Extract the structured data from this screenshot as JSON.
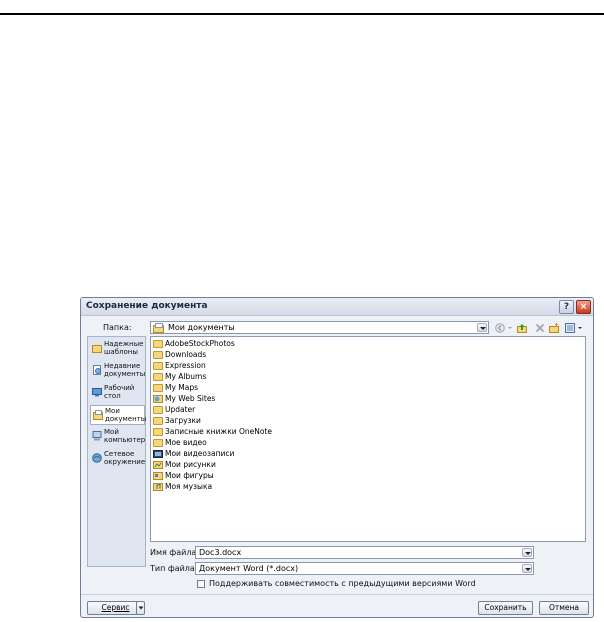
{
  "dialog": {
    "title": "Сохранение документа",
    "help_glyph": "?",
    "close_glyph": "×"
  },
  "folder_label": "Папка:",
  "folder_value": "Мои документы",
  "places": [
    {
      "label": "Надежные шаблоны",
      "icon": "folder-icon"
    },
    {
      "label": "Недавние документы",
      "icon": "recent-docs-icon"
    },
    {
      "label": "Рабочий стол",
      "icon": "desktop-icon"
    },
    {
      "label": "Мои документы",
      "icon": "my-documents-icon"
    },
    {
      "label": "Мой компьютер",
      "icon": "computer-icon"
    },
    {
      "label": "Сетевое окружение",
      "icon": "network-icon"
    }
  ],
  "files": [
    "AdobeStockPhotos",
    "Downloads",
    "Expression",
    "My Albums",
    "My Maps",
    "My Web Sites",
    "Updater",
    "Загрузки",
    "Записные книжки OneNote",
    "Мое видео",
    "Мои видеозаписи",
    "Мои рисунки",
    "Мои фигуры",
    "Моя музыка"
  ],
  "filename_label": "Имя файла:",
  "filename_value": "Doc3.docx",
  "filetype_label": "Тип файла:",
  "filetype_value": "Документ Word (*.docx)",
  "compat_label": "Поддерживать совместимость с предыдущими версиями Word",
  "compat_checked": false,
  "service_button": "Сервис",
  "save_button": "Сохранить",
  "cancel_button": "Отмена",
  "colors": {
    "folder": "#f6d67a",
    "close": "#c8391a",
    "accent": "#1f5fb8"
  }
}
